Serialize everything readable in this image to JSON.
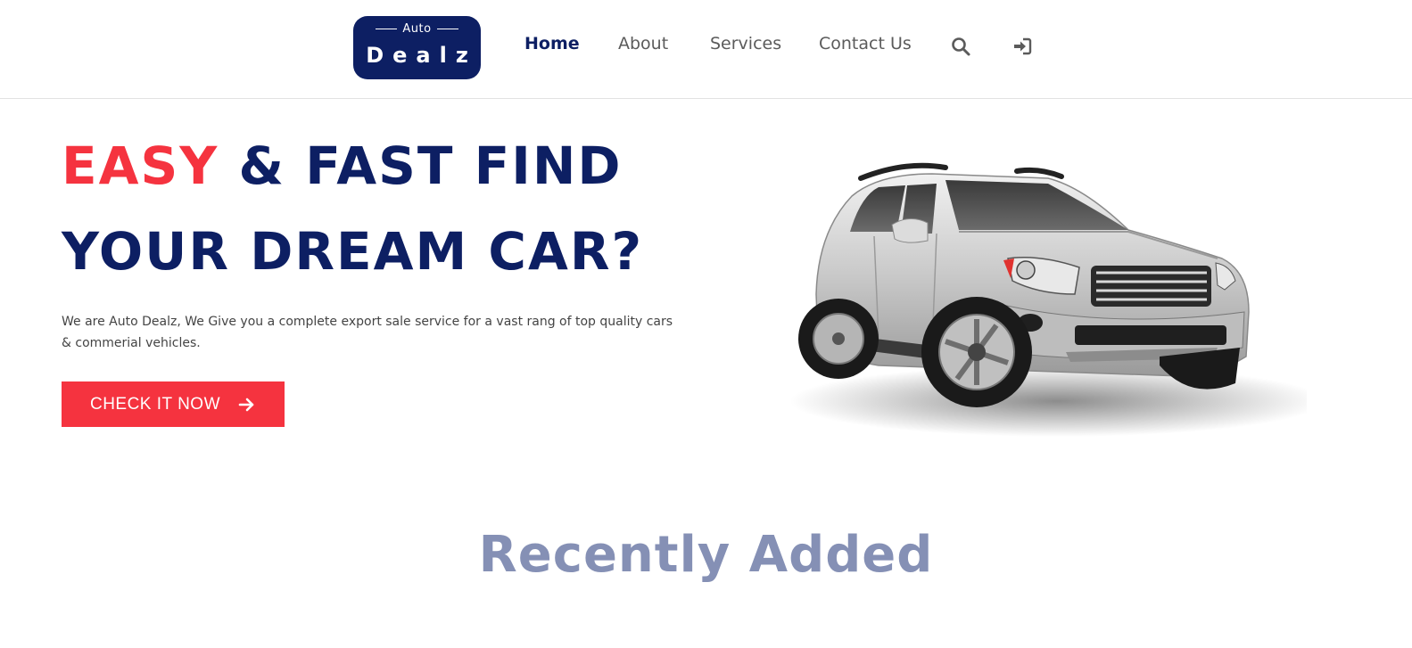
{
  "brand": {
    "top": "Auto",
    "bottom": "Dealz"
  },
  "nav": {
    "items": [
      {
        "label": "Home",
        "active": true
      },
      {
        "label": "About",
        "active": false
      },
      {
        "label": "Services",
        "active": false
      },
      {
        "label": "Contact Us",
        "active": false
      }
    ],
    "icons": [
      "search-icon",
      "login-icon"
    ]
  },
  "hero": {
    "title_accent": "EASY",
    "title_rest_line1": " & FAST FIND",
    "title_line2": "YOUR DREAM CAR?",
    "description": "We are Auto Dealz, We Give you a complete export sale service for a vast rang of top quality cars & commerial vehicles.",
    "cta_label": "CHECK IT NOW"
  },
  "sections": {
    "recent_title": "Recently Added"
  },
  "colors": {
    "primary": "#0d1f63",
    "accent": "#f5333f",
    "muted_heading": "#8590b5"
  }
}
